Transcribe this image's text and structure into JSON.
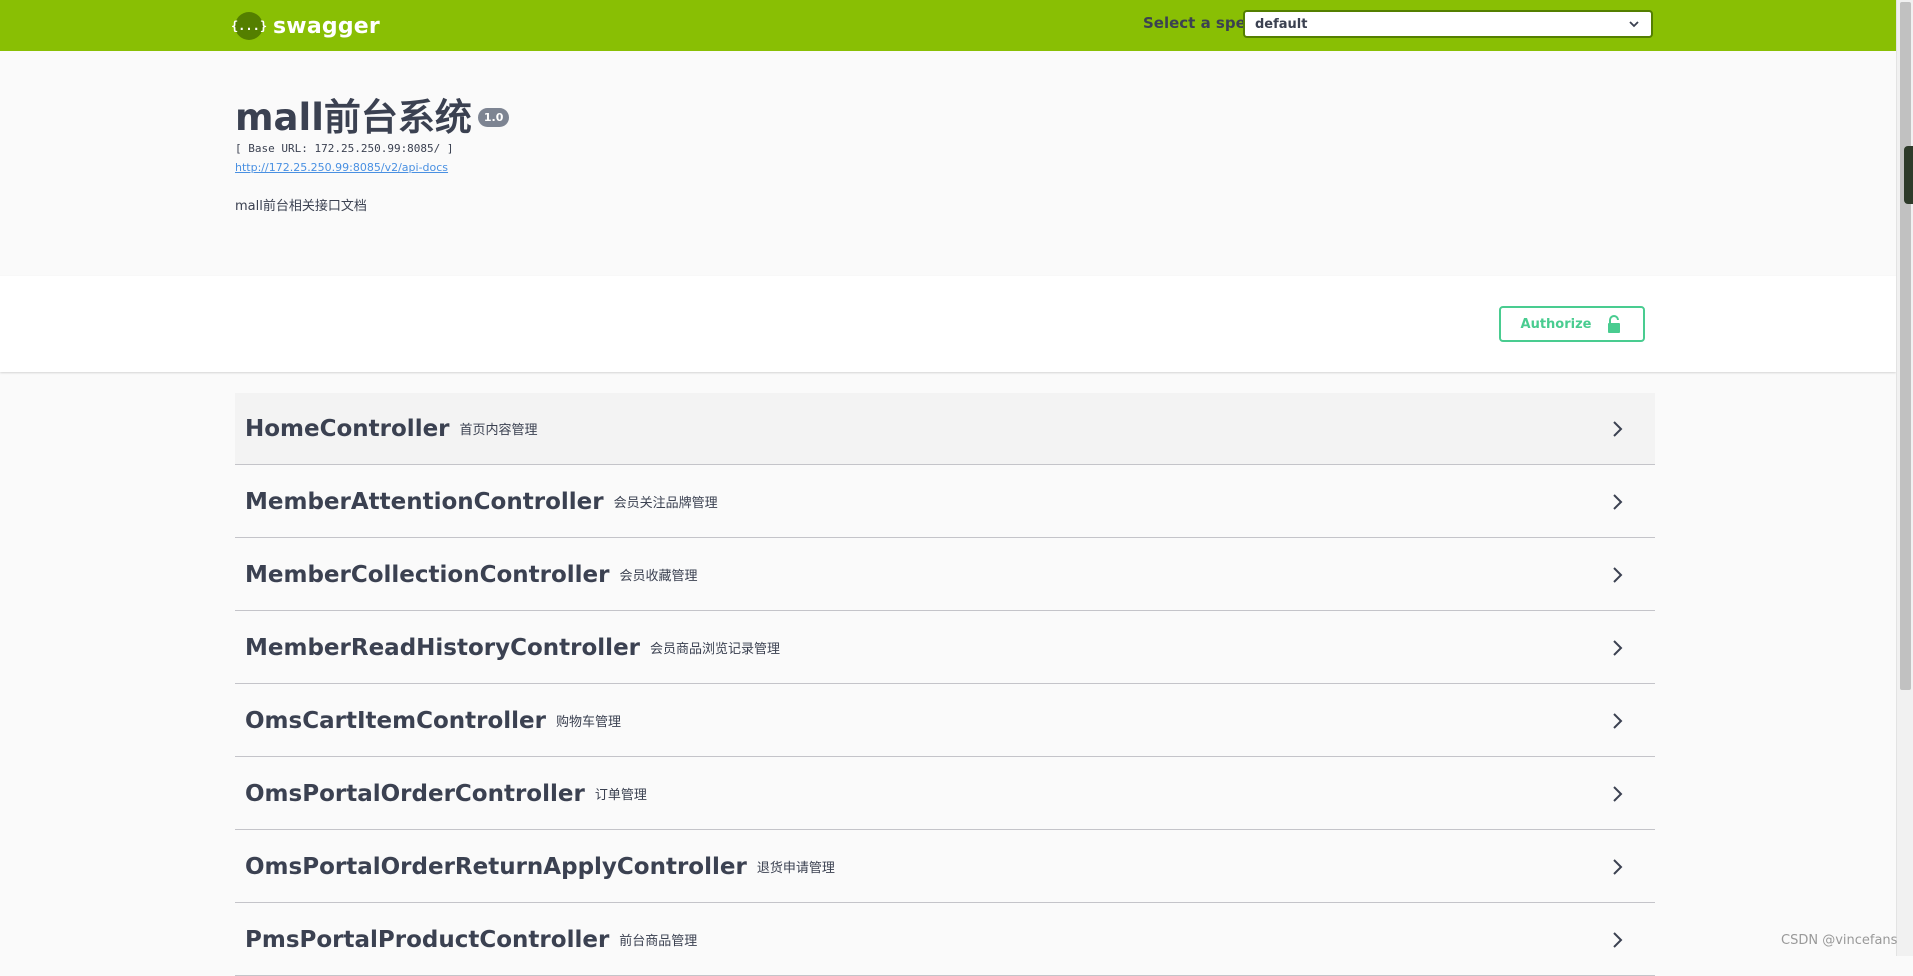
{
  "topbar": {
    "logo_text": "swagger",
    "logo_glyph": "{...}",
    "spec_label": "Select a spec",
    "spec_selected": "default",
    "bar_color": "#89bf04"
  },
  "info": {
    "title": "mall前台系统",
    "version": "1.0",
    "base_url": "[ Base URL: 172.25.250.99:8085/ ]",
    "api_docs_link": "http://172.25.250.99:8085/v2/api-docs",
    "description": "mall前台相关接口文档"
  },
  "scheme": {
    "authorize_label": "Authorize",
    "authorize_color": "#49cc90"
  },
  "controllers": [
    {
      "name": "HomeController",
      "desc": "首页内容管理"
    },
    {
      "name": "MemberAttentionController",
      "desc": "会员关注品牌管理"
    },
    {
      "name": "MemberCollectionController",
      "desc": "会员收藏管理"
    },
    {
      "name": "MemberReadHistoryController",
      "desc": "会员商品浏览记录管理"
    },
    {
      "name": "OmsCartItemController",
      "desc": "购物车管理"
    },
    {
      "name": "OmsPortalOrderController",
      "desc": "订单管理"
    },
    {
      "name": "OmsPortalOrderReturnApplyController",
      "desc": "退货申请管理"
    },
    {
      "name": "PmsPortalProductController",
      "desc": "前台商品管理"
    }
  ],
  "watermark": "CSDN @vincefans"
}
